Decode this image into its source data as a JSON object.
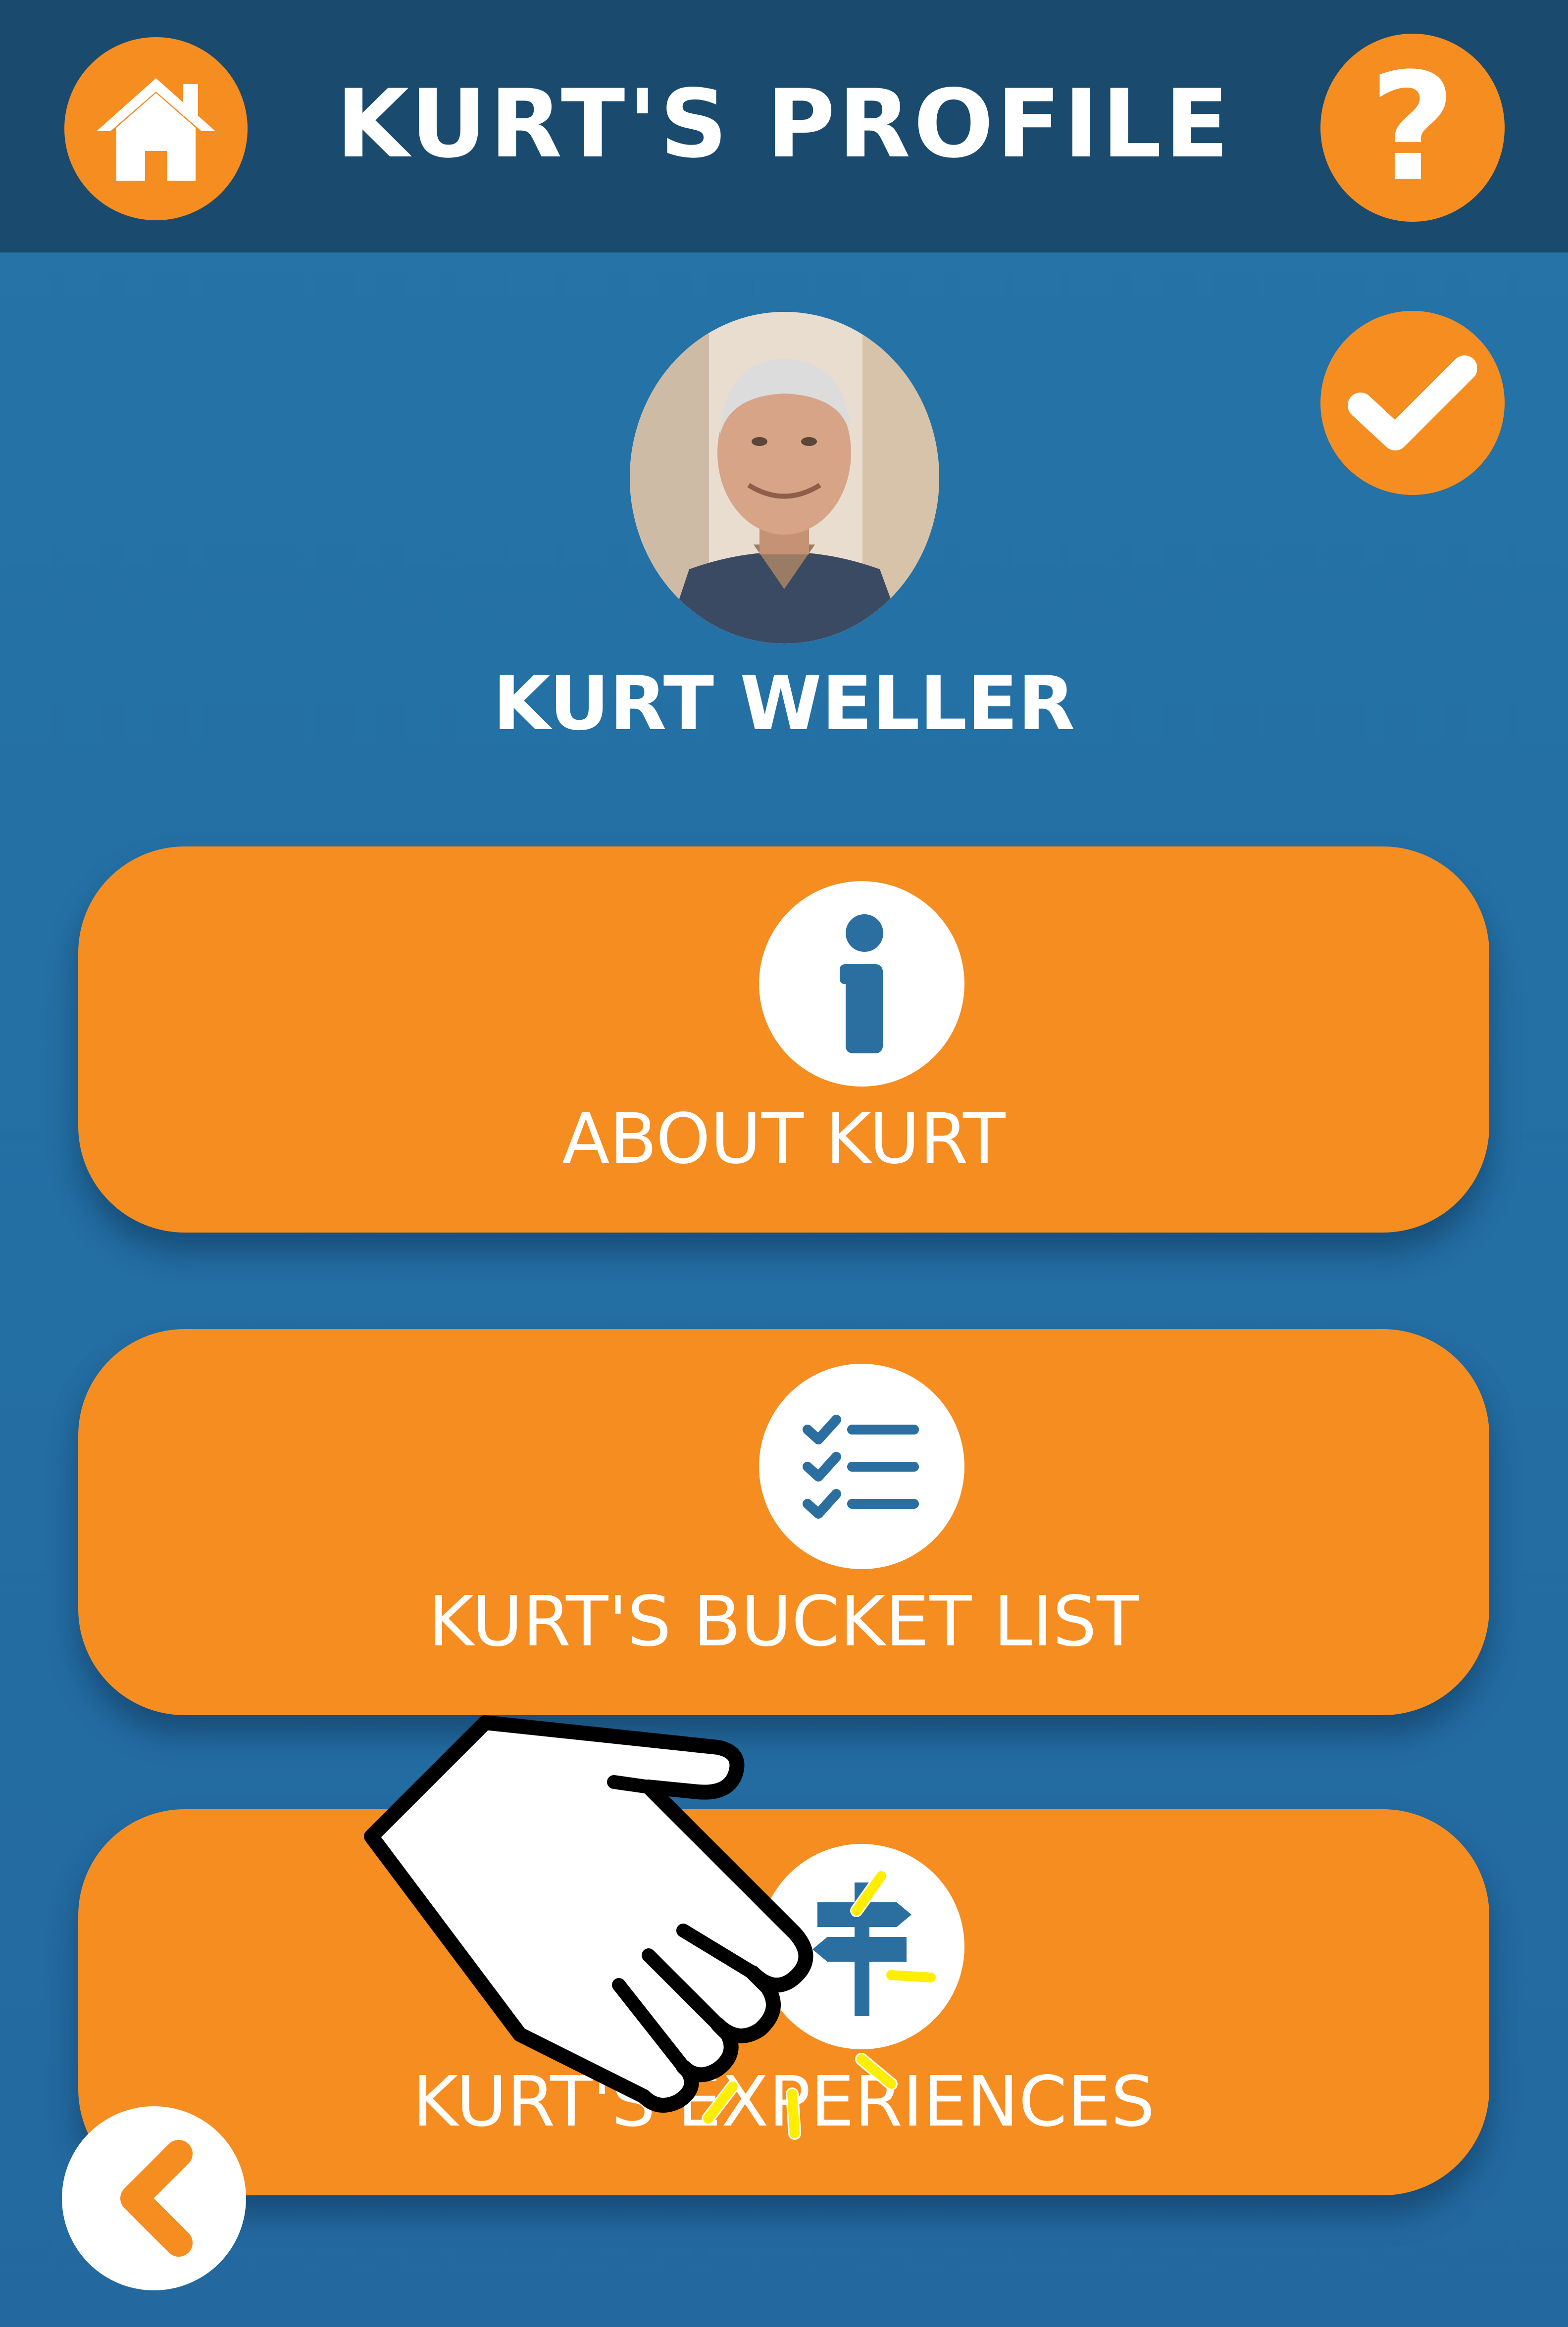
{
  "header": {
    "title": "KURT'S PROFILE",
    "home_icon": "home-icon",
    "help_icon": "help-icon",
    "help_glyph": "?"
  },
  "profile": {
    "name": "KURT WELLER",
    "avatar": "profile-photo",
    "confirm_icon": "check-icon"
  },
  "menu": {
    "items": [
      {
        "label": "ABOUT KURT",
        "icon": "info-icon"
      },
      {
        "label": "KURT'S BUCKET LIST",
        "icon": "checklist-icon"
      },
      {
        "label": "KURT'S EXPERIENCES",
        "icon": "signpost-icon"
      }
    ]
  },
  "footer": {
    "back_icon": "back-chevron-icon"
  },
  "overlay": {
    "pointer_icon": "pointing-hand-icon"
  },
  "colors": {
    "accent_orange": "#f58d20",
    "header_navy": "#1a4b6e",
    "background_blue": "#2674a8",
    "icon_blue": "#2a6fa0",
    "white": "#ffffff"
  }
}
